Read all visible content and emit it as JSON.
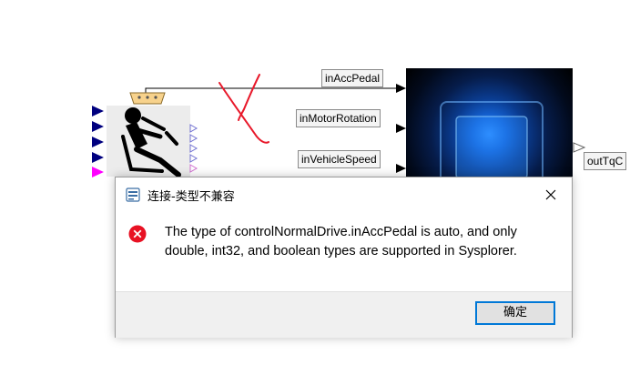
{
  "diagram": {
    "ports": {
      "acc_pedal": "inAccPedal",
      "motor_rotation": "inMotorRotation",
      "vehicle_speed": "inVehicleSpeed",
      "output": "outTqC"
    },
    "annotation_color": "#e8182a",
    "controller_icon": "cpu-chip-icon",
    "driver_icon": "seated-driver-icon"
  },
  "dialog": {
    "title": "连接-类型不兼容",
    "message": "The type of controlNormalDrive.inAccPedal is auto, and only double, int32, and boolean types are supported in Sysplorer.",
    "ok_label": "确定",
    "icon": "error-icon",
    "accent": "#0078d7"
  }
}
